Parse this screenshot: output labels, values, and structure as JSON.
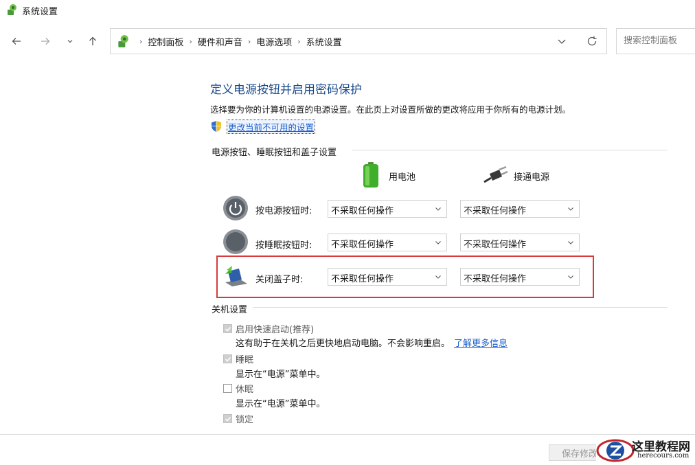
{
  "window": {
    "title": "系统设置"
  },
  "address": {
    "crumbs": [
      "控制面板",
      "硬件和声音",
      "电源选项",
      "系统设置"
    ]
  },
  "search": {
    "placeholder": "搜索控制面板"
  },
  "page": {
    "heading": "定义电源按钮并启用密码保护",
    "description": "选择要为你的计算机设置的电源设置。在此页上对设置所做的更改将应用于你所有的电源计划。",
    "change_link": "更改当前不可用的设置"
  },
  "power_section": {
    "title": "电源按钮、睡眠按钮和盖子设置",
    "battery_label": "用电池",
    "plugged_label": "接通电源",
    "rows": [
      {
        "label": "按电源按钮时:",
        "battery": "不采取任何操作",
        "plugged": "不采取任何操作"
      },
      {
        "label": "按睡眠按钮时:",
        "battery": "不采取任何操作",
        "plugged": "不采取任何操作"
      },
      {
        "label": "关闭盖子时:",
        "battery": "不采取任何操作",
        "plugged": "不采取任何操作"
      }
    ]
  },
  "shutdown_section": {
    "title": "关机设置",
    "items": [
      {
        "label": "启用快速启动(推荐)",
        "checked": true,
        "desc": "这有助于在关机之后更快地启动电脑。不会影响重启。",
        "link": "了解更多信息"
      },
      {
        "label": "睡眠",
        "checked": true,
        "desc": "显示在“电源”菜单中。"
      },
      {
        "label": "休眠",
        "checked": false,
        "desc": "显示在“电源”菜单中。"
      },
      {
        "label": "锁定",
        "checked": true
      }
    ]
  },
  "footer": {
    "save_label": "保存修改"
  },
  "watermark": {
    "name": "这里教程网",
    "url": "herecours.com"
  },
  "colors": {
    "heading": "#1a4a8a",
    "link": "#1a5ec9",
    "highlight": "#d63a3a"
  }
}
